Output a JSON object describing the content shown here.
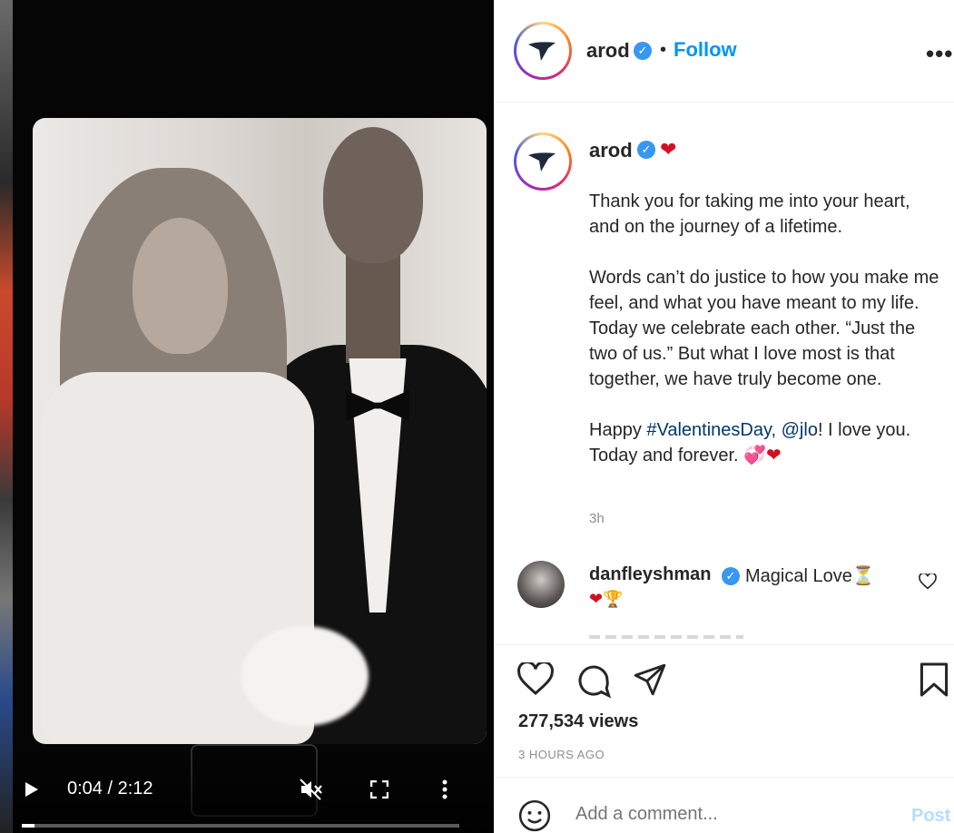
{
  "video": {
    "time": "0:04 / 2:12",
    "progress": 0.03
  },
  "header": {
    "username": "arod",
    "separator": "•",
    "follow_label": "Follow",
    "more_label": "•••"
  },
  "caption": {
    "username": "arod",
    "heart": "❤",
    "paragraph1": "Thank you for taking me into your heart, and on the journey of a lifetime.",
    "paragraph2": "Words can’t do justice to how you make me feel, and what you have meant to my life. Today we celebrate each other. “Just the two of us.” But what I love most is that together, we have truly become one.",
    "p3_prefix": "Happy ",
    "p3_hashtag": "#ValentinesDay,",
    "p3_mention": "@jlo",
    "p3_suffix": "! I love you. Today and forever. ",
    "p3_emoji": "💞❤",
    "time_ago": "3h"
  },
  "comment": {
    "username": "danfleyshman",
    "text": "Magical Love⏳",
    "emoji": "❤🏆"
  },
  "stats": {
    "views": "277,534 views",
    "posted": "3 HOURS AGO"
  },
  "compose": {
    "placeholder": "Add a comment...",
    "post_label": "Post"
  },
  "colors": {
    "accent": "#0095f6",
    "verified": "#3897f0",
    "heart": "#d40f1f"
  }
}
